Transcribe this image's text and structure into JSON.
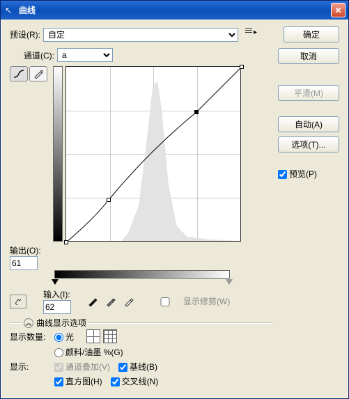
{
  "title": "曲线",
  "preset": {
    "label": "预设(R):",
    "value": "自定"
  },
  "channel": {
    "label": "通道(C):",
    "value": "a"
  },
  "buttons": {
    "ok": "确定",
    "cancel": "取消",
    "smooth": "平滑(M)",
    "auto": "自动(A)",
    "options": "选项(T)..."
  },
  "preview": {
    "label": "预览(P)",
    "checked": true
  },
  "output": {
    "label": "输出(O):",
    "value": "61"
  },
  "input": {
    "label": "输入(I):",
    "value": "62"
  },
  "show_clipping": {
    "label": "显示修剪(W)",
    "checked": false
  },
  "display_options_header": "曲线显示选项",
  "qty": {
    "label": "显示数量:",
    "light": "光",
    "pigment": "颜料/油墨 %(G)"
  },
  "show": {
    "label": "显示:",
    "overlay": "通道叠加(V)",
    "baseline": "基线(B)",
    "histogram": "直方图(H)",
    "intersection": "交叉线(N)"
  },
  "chart_data": {
    "type": "line",
    "title": "",
    "xlabel": "输入",
    "ylabel": "输出",
    "xlim": [
      0,
      255
    ],
    "ylim": [
      0,
      255
    ],
    "points": [
      {
        "x": 0,
        "y": 0
      },
      {
        "x": 62,
        "y": 61
      },
      {
        "x": 189,
        "y": 189
      },
      {
        "x": 255,
        "y": 255
      }
    ],
    "selected_point_index": 1,
    "histogram_peak_x": 128
  }
}
